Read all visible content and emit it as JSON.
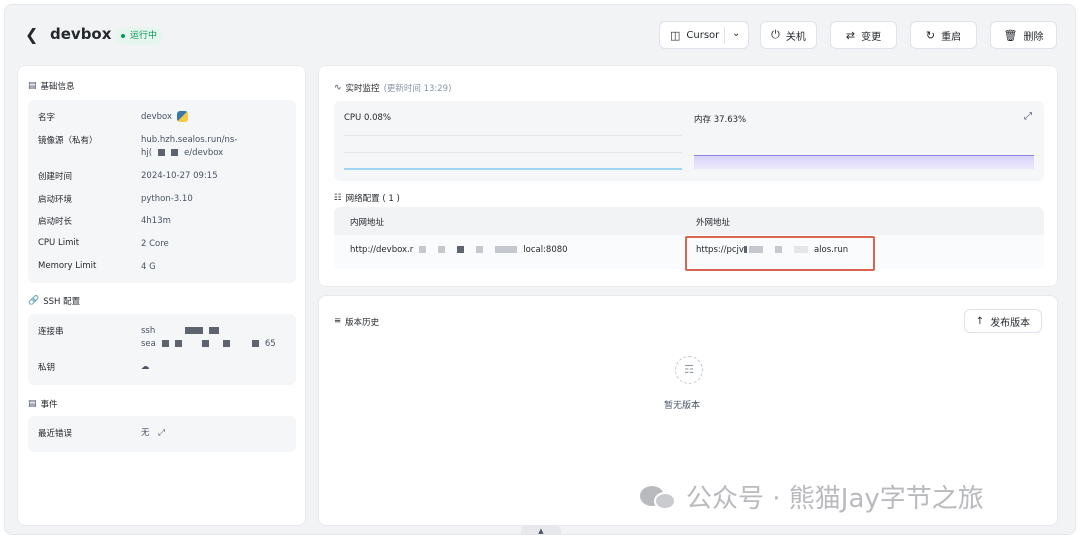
{
  "header": {
    "back_icon": "chevron-left-icon",
    "title": "devbox",
    "status": "运行中",
    "buttons": {
      "cursor": "Cursor",
      "shutdown": "关机",
      "change": "变更",
      "restart": "重启",
      "delete": "删除"
    }
  },
  "basic_info": {
    "title": "基础信息",
    "rows": [
      {
        "label": "名字",
        "value": "devbox"
      },
      {
        "label": "镜像源（私有）",
        "value_line1": "hub.hzh.sealos.run/ns-",
        "value_line2_a": "hj(",
        "value_line2_b": "e/devbox"
      },
      {
        "label": "创建时间",
        "value": "2024-10-27 09:15"
      },
      {
        "label": "启动环境",
        "value": "python-3.10"
      },
      {
        "label": "启动时长",
        "value": "4h13m"
      },
      {
        "label": "CPU Limit",
        "value": "2 Core"
      },
      {
        "label": "Memory Limit",
        "value": "4 G"
      }
    ]
  },
  "ssh": {
    "title": "SSH 配置",
    "conn_label": "连接串",
    "conn_line1": "ssh",
    "conn_line2a": "sea",
    "conn_line2b": "65",
    "key_label": "私钥"
  },
  "events": {
    "title": "事件",
    "last_error_label": "最近错误",
    "last_error_value": "无"
  },
  "monitor": {
    "title": "实时监控",
    "updated": "(更新时间 13:29)",
    "cpu_label": "CPU 0.08%",
    "mem_label": "内存 37.63%",
    "cpu_percent": 0.08,
    "mem_percent": 37.63
  },
  "network": {
    "title": "网络配置 ( 1 )",
    "col_internal": "内网地址",
    "col_external": "外网地址",
    "internal_a": "http://devbox.r",
    "internal_b": "local:8080",
    "external_a": "https://pcjv",
    "external_b": "alos.run"
  },
  "versions": {
    "title": "版本历史",
    "publish_button": "发布版本",
    "empty_text": "暂无版本"
  },
  "watermark": "公众号 · 熊猫Jay字节之旅",
  "colors": {
    "status_green": "#039855",
    "cpu_line": "#9fd5f0",
    "mem_line": "#8f80e6",
    "highlight_border": "#d9644f"
  }
}
